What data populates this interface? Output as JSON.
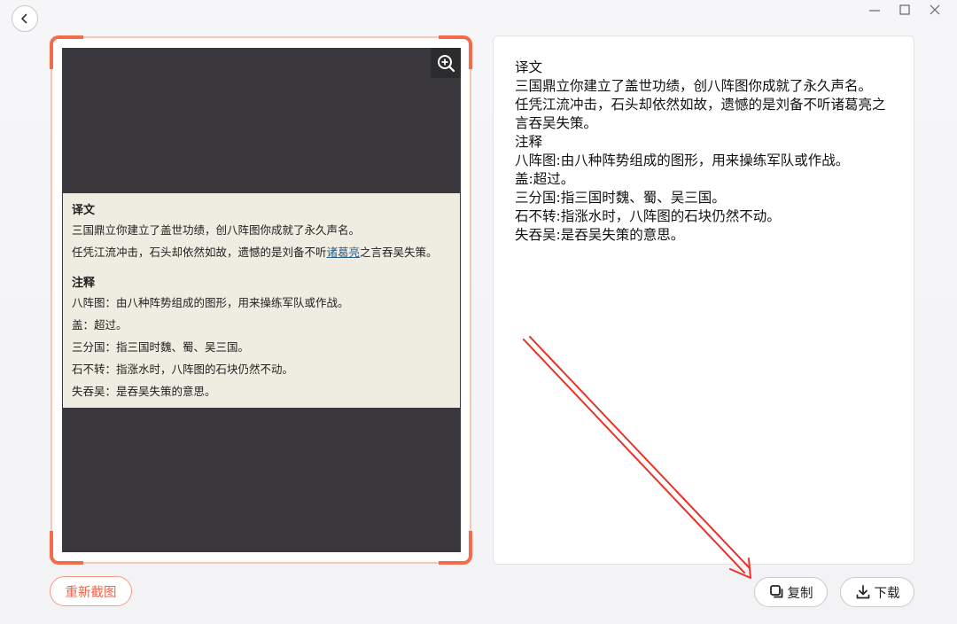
{
  "window": {
    "back_icon": "chevron-left-icon",
    "minimize_icon": "minimize-icon",
    "maximize_icon": "maximize-icon",
    "close_icon": "close-icon"
  },
  "screenshot": {
    "zoom_icon": "zoom-in-icon",
    "content": {
      "heading1": "译文",
      "line1": "三国鼎立你建立了盖世功绩，创八阵图你成就了永久声名。",
      "line2_before": "任凭江流冲击，石头却依然如故，遗憾的是刘备不听",
      "line2_link": "诸葛亮",
      "line2_after": "之言吞吴失策。",
      "heading2": "注释",
      "notes": [
        "八阵图：由八种阵势组成的图形，用来操练军队或作战。",
        "盖：超过。",
        "三分国：指三国时魏、蜀、吴三国。",
        "石不转：指涨水时，八阵图的石块仍然不动。",
        "失吞吴：是吞吴失策的意思。"
      ]
    }
  },
  "result": {
    "lines": [
      "译文",
      "三国鼎立你建立了盖世功绩，创八阵图你成就了永久声名。",
      "任凭江流冲击，石头却依然如故，遗憾的是刘备不听诸葛亮之",
      "言吞吴失策。",
      "注释",
      "八阵图:由八种阵势组成的图形，用来操练军队或作战。",
      "盖:超过。",
      "三分国:指三国时魏、蜀、吴三国。",
      "石不转:指涨水时，八阵图的石块仍然不动。",
      "失吞吴:是吞吴失策的意思。"
    ]
  },
  "actions": {
    "recapture_label": "重新截图",
    "copy_label": "复制",
    "copy_icon": "copy-icon",
    "download_label": "下载",
    "download_icon": "download-icon"
  },
  "colors": {
    "accent": "#f26b4b",
    "annotation_arrow": "#e8332a",
    "dark_bg": "#3a383c",
    "paper_bg": "#efede1"
  }
}
